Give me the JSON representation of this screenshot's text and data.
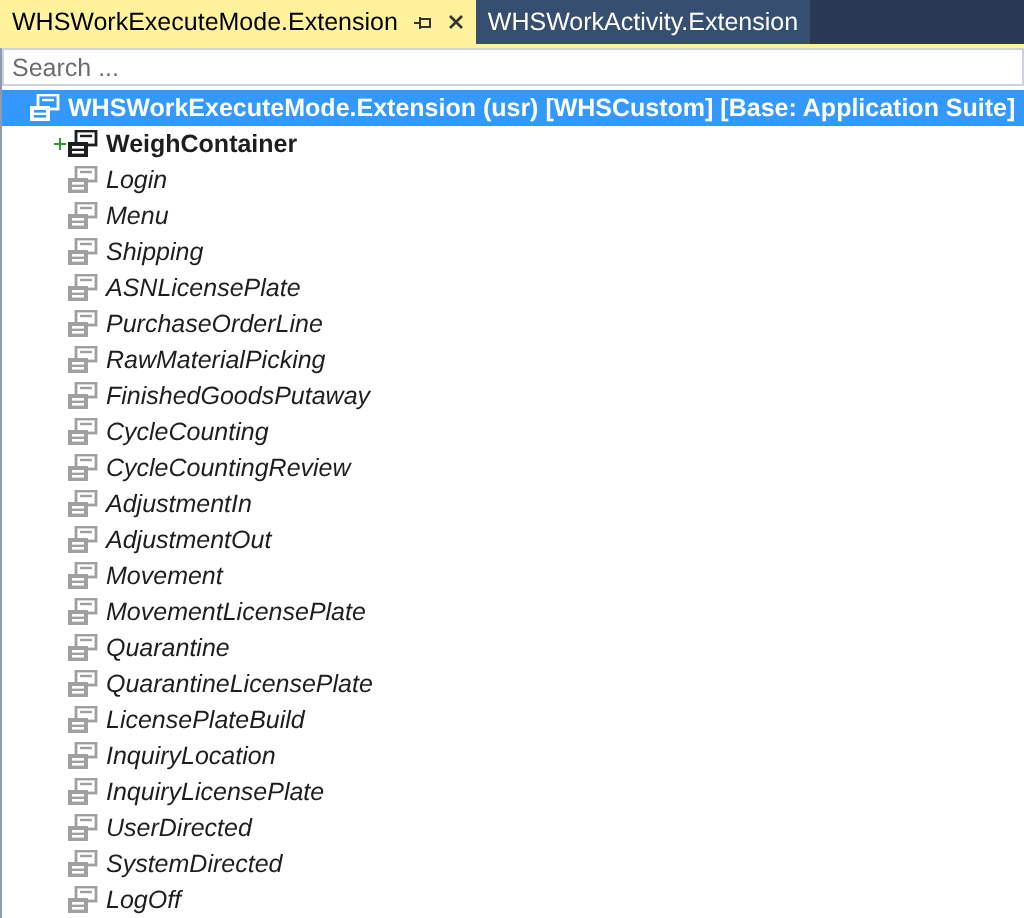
{
  "tabs": [
    {
      "label": "WHSWorkExecuteMode.Extension",
      "selected": true
    },
    {
      "label": "WHSWorkActivity.Extension",
      "selected": false
    }
  ],
  "search": {
    "placeholder": "Search ..."
  },
  "tree": {
    "label": "WHSWorkExecuteMode.Extension (usr) [WHSCustom] [Base: Application Suite]",
    "selected": true,
    "children": [
      {
        "label": "WeighContainer",
        "kind": "added",
        "selected": false
      },
      {
        "label": "Login",
        "kind": "inherited",
        "selected": false
      },
      {
        "label": "Menu",
        "kind": "inherited",
        "selected": false
      },
      {
        "label": "Shipping",
        "kind": "inherited",
        "selected": false
      },
      {
        "label": "ASNLicensePlate",
        "kind": "inherited",
        "selected": false
      },
      {
        "label": "PurchaseOrderLine",
        "kind": "inherited",
        "selected": false
      },
      {
        "label": "RawMaterialPicking",
        "kind": "inherited",
        "selected": false
      },
      {
        "label": "FinishedGoodsPutaway",
        "kind": "inherited",
        "selected": false
      },
      {
        "label": "CycleCounting",
        "kind": "inherited",
        "selected": false
      },
      {
        "label": "CycleCountingReview",
        "kind": "inherited",
        "selected": false
      },
      {
        "label": "AdjustmentIn",
        "kind": "inherited",
        "selected": false
      },
      {
        "label": "AdjustmentOut",
        "kind": "inherited",
        "selected": false
      },
      {
        "label": "Movement",
        "kind": "inherited",
        "selected": false
      },
      {
        "label": "MovementLicensePlate",
        "kind": "inherited",
        "selected": false
      },
      {
        "label": "Quarantine",
        "kind": "inherited",
        "selected": false
      },
      {
        "label": "QuarantineLicensePlate",
        "kind": "inherited",
        "selected": false
      },
      {
        "label": "LicensePlateBuild",
        "kind": "inherited",
        "selected": false
      },
      {
        "label": "InquiryLocation",
        "kind": "inherited",
        "selected": false
      },
      {
        "label": "InquiryLicensePlate",
        "kind": "inherited",
        "selected": false
      },
      {
        "label": "UserDirected",
        "kind": "inherited",
        "selected": false
      },
      {
        "label": "SystemDirected",
        "kind": "inherited",
        "selected": false
      },
      {
        "label": "LogOff",
        "kind": "inherited",
        "selected": false
      }
    ]
  }
}
